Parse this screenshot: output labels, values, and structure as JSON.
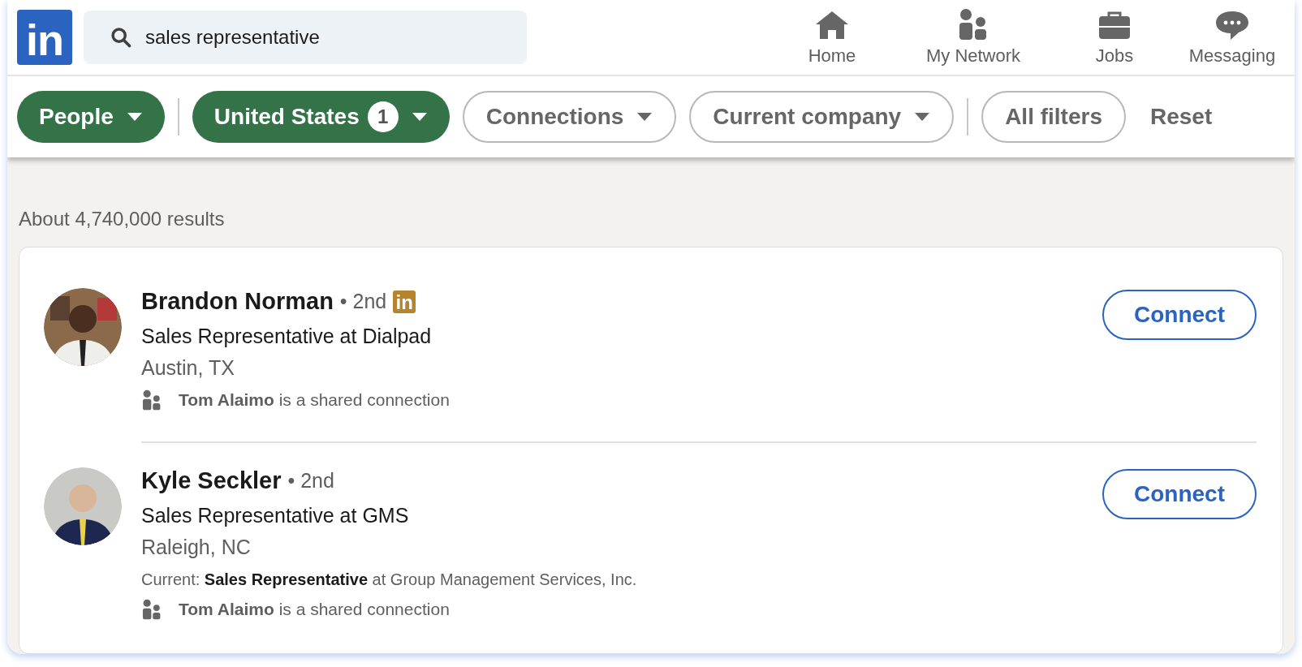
{
  "logo": {
    "text": "in"
  },
  "search": {
    "value": "sales representative"
  },
  "nav": [
    {
      "label": "Home"
    },
    {
      "label": "My Network"
    },
    {
      "label": "Jobs"
    },
    {
      "label": "Messaging"
    }
  ],
  "filters": [
    {
      "label": "People",
      "selected": true,
      "dropdown": true
    },
    {
      "kind": "divider"
    },
    {
      "label": "United States",
      "selected": true,
      "count": "1",
      "dropdown": true
    },
    {
      "label": "Connections",
      "selected": false,
      "dropdown": true
    },
    {
      "label": "Current company",
      "selected": false,
      "dropdown": true
    },
    {
      "kind": "divider"
    },
    {
      "label": "All filters",
      "selected": false,
      "dropdown": false
    }
  ],
  "reset": "Reset",
  "results_count": "About 4,740,000 results",
  "results": [
    {
      "name": "Brandon Norman",
      "degree": "• 2nd",
      "premium_badge": "in",
      "headline": "Sales Representative at Dialpad",
      "location": "Austin, TX",
      "shared": "**Tom Alaimo** is a shared connection",
      "action": "Connect"
    },
    {
      "name": "Kyle Seckler",
      "degree": "• 2nd",
      "headline": "Sales Representative at GMS",
      "location": "Raleigh, NC",
      "current": "Current: **Sales Representative** at Group Management Services, Inc.",
      "shared": "**Tom Alaimo** is a shared connection",
      "action": "Connect"
    }
  ]
}
